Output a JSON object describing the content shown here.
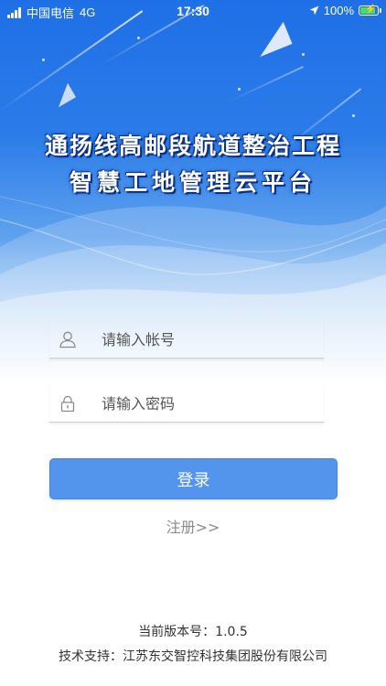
{
  "status_bar": {
    "carrier": "中国电信",
    "network": "4G",
    "time": "17:30",
    "battery": "100%",
    "battery_level": 1.0,
    "battery_color": "#4cd964"
  },
  "header": {
    "title_line1": "通扬线高邮段航道整治工程",
    "title_line2": "智慧工地管理云平台"
  },
  "form": {
    "account_placeholder": "请输入帐号",
    "account_value": "",
    "password_placeholder": "请输入密码",
    "password_value": "",
    "account_icon": "user-icon",
    "password_icon": "lock-icon",
    "login_label": "登录",
    "register_label": "注册>>"
  },
  "footer": {
    "version": "当前版本号：1.0.5",
    "support": "技术支持：江苏东交智控科技集团股份有限公司"
  },
  "colors": {
    "primary": "#5394ec",
    "header_blue": "#1f6fe6"
  }
}
